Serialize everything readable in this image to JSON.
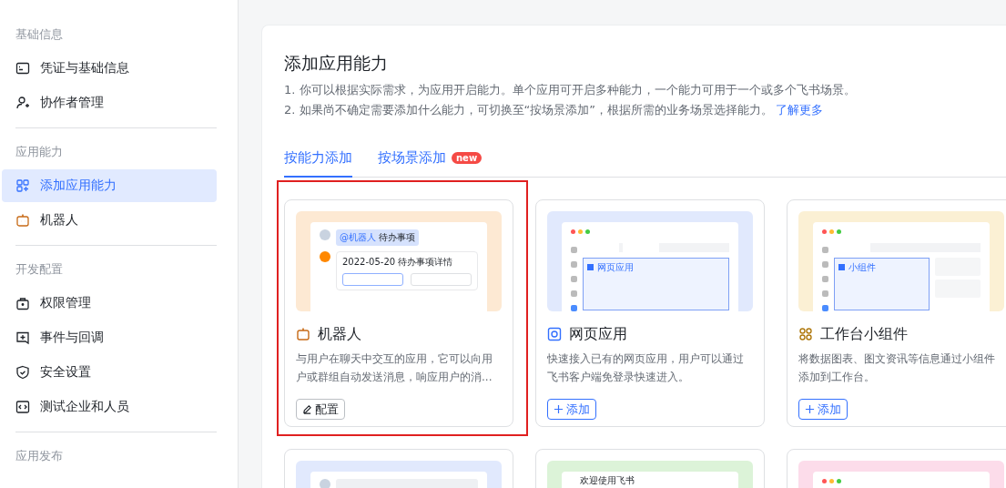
{
  "sidebar": {
    "sections": [
      {
        "heading": "基础信息",
        "items": [
          {
            "label": "凭证与基础信息",
            "selected": false
          },
          {
            "label": "协作者管理",
            "selected": false
          }
        ]
      },
      {
        "heading": "应用能力",
        "items": [
          {
            "label": "添加应用能力",
            "selected": true
          },
          {
            "label": "机器人",
            "selected": false
          }
        ]
      },
      {
        "heading": "开发配置",
        "items": [
          {
            "label": "权限管理",
            "selected": false
          },
          {
            "label": "事件与回调",
            "selected": false
          },
          {
            "label": "安全设置",
            "selected": false
          },
          {
            "label": "测试企业和人员",
            "selected": false
          }
        ]
      },
      {
        "heading": "应用发布"
      }
    ]
  },
  "panel": {
    "title": "添加应用能力",
    "notes": [
      {
        "text": "1. 你可以根据实际需求，为应用开启能力。单个应用可开启多种能力，一个能力可用于一个或多个飞书场景。"
      },
      {
        "text": "2. 如果尚不确定需要添加什么能力，可切换至“按场景添加”，根据所需的业务场景选择能力。",
        "link": "了解更多"
      }
    ],
    "tabs": [
      {
        "label": "按能力添加",
        "selected": true
      },
      {
        "label": "按场景添加",
        "selected": false,
        "badge": "new"
      }
    ],
    "cards": [
      {
        "kind": "bot",
        "highlighted": true,
        "title": "机器人",
        "description": "与用户在聊天中交互的应用，它可以向用户或群组自动发送消息，响应用户的消...",
        "action": {
          "kind": "configure",
          "label": "配置"
        },
        "preview": {
          "texts": [
            "@机器人",
            "待办事项",
            "2022-05-20 待办事项详情"
          ]
        }
      },
      {
        "kind": "web",
        "highlighted": false,
        "title": "网页应用",
        "description": "快速接入已有的网页应用，用户可以通过飞书客户端免登录快速进入。",
        "action": {
          "kind": "add",
          "label": "添加"
        },
        "preview": {
          "texts": [
            "网页应用"
          ]
        }
      },
      {
        "kind": "widget",
        "highlighted": false,
        "title": "工作台小组件",
        "description": "将数据图表、图文资讯等信息通过小组件添加到工作台。",
        "action": {
          "kind": "add",
          "label": "添加"
        },
        "preview": {
          "texts": [
            "小组件"
          ]
        }
      },
      {
        "kind": "chat",
        "highlighted": false
      },
      {
        "kind": "welcome",
        "highlighted": false,
        "preview": {
          "texts": [
            "欢迎使用飞书"
          ]
        }
      },
      {
        "kind": "browser",
        "highlighted": false
      }
    ]
  }
}
